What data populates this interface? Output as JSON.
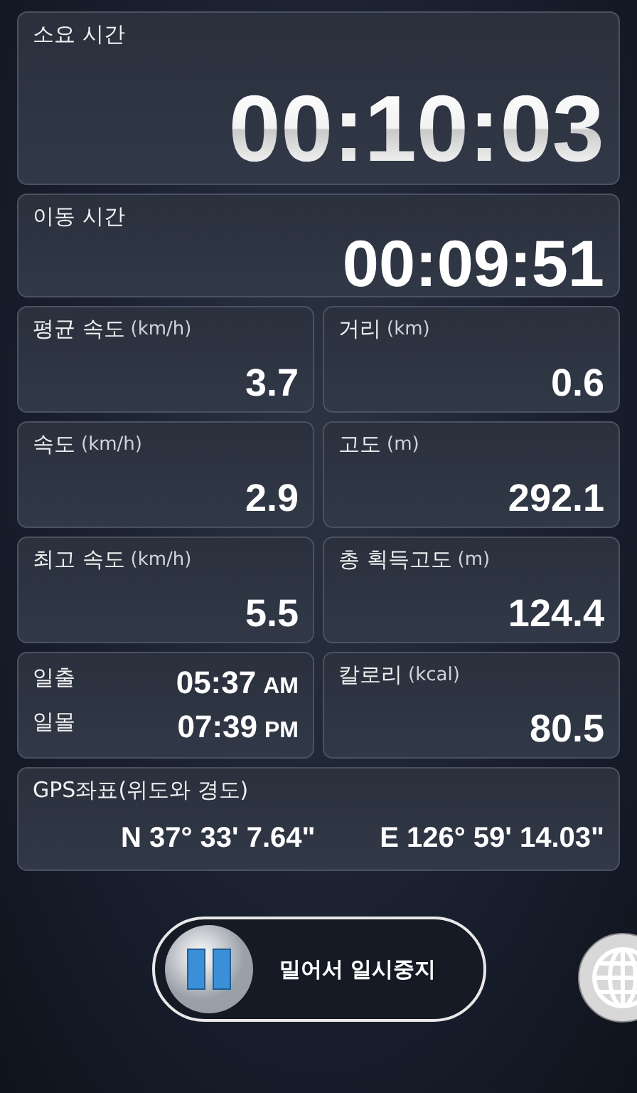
{
  "elapsed": {
    "label": "소요 시간",
    "value": "00:10:03"
  },
  "moving": {
    "label": "이동 시간",
    "value": "00:09:51"
  },
  "stats": [
    {
      "kind": "stat",
      "label": "평균 속도",
      "unit": "(km/h)",
      "value": "3.7"
    },
    {
      "kind": "stat",
      "label": "거리",
      "unit": "(km)",
      "value": "0.6"
    },
    {
      "kind": "stat",
      "label": "속도",
      "unit": "(km/h)",
      "value": "2.9"
    },
    {
      "kind": "stat",
      "label": "고도",
      "unit": "(m)",
      "value": "292.1"
    },
    {
      "kind": "stat",
      "label": "최고 속도",
      "unit": "(km/h)",
      "value": "5.5"
    },
    {
      "kind": "stat",
      "label": "총 획득고도",
      "unit": "(m)",
      "value": "124.4"
    },
    {
      "kind": "sun",
      "rows": [
        {
          "label": "일출",
          "time": "05:37",
          "ampm": "AM"
        },
        {
          "label": "일몰",
          "time": "07:39",
          "ampm": "PM"
        }
      ]
    },
    {
      "kind": "stat",
      "label": "칼로리",
      "unit": "(kcal)",
      "value": "80.5"
    }
  ],
  "gps": {
    "label": "GPS좌표(위도와 경도)",
    "latitude": "N 37° 33' 7.64\"",
    "longitude": "E 126° 59' 14.03\""
  },
  "slider": {
    "label": "밀어서 일시중지",
    "level": 0
  }
}
